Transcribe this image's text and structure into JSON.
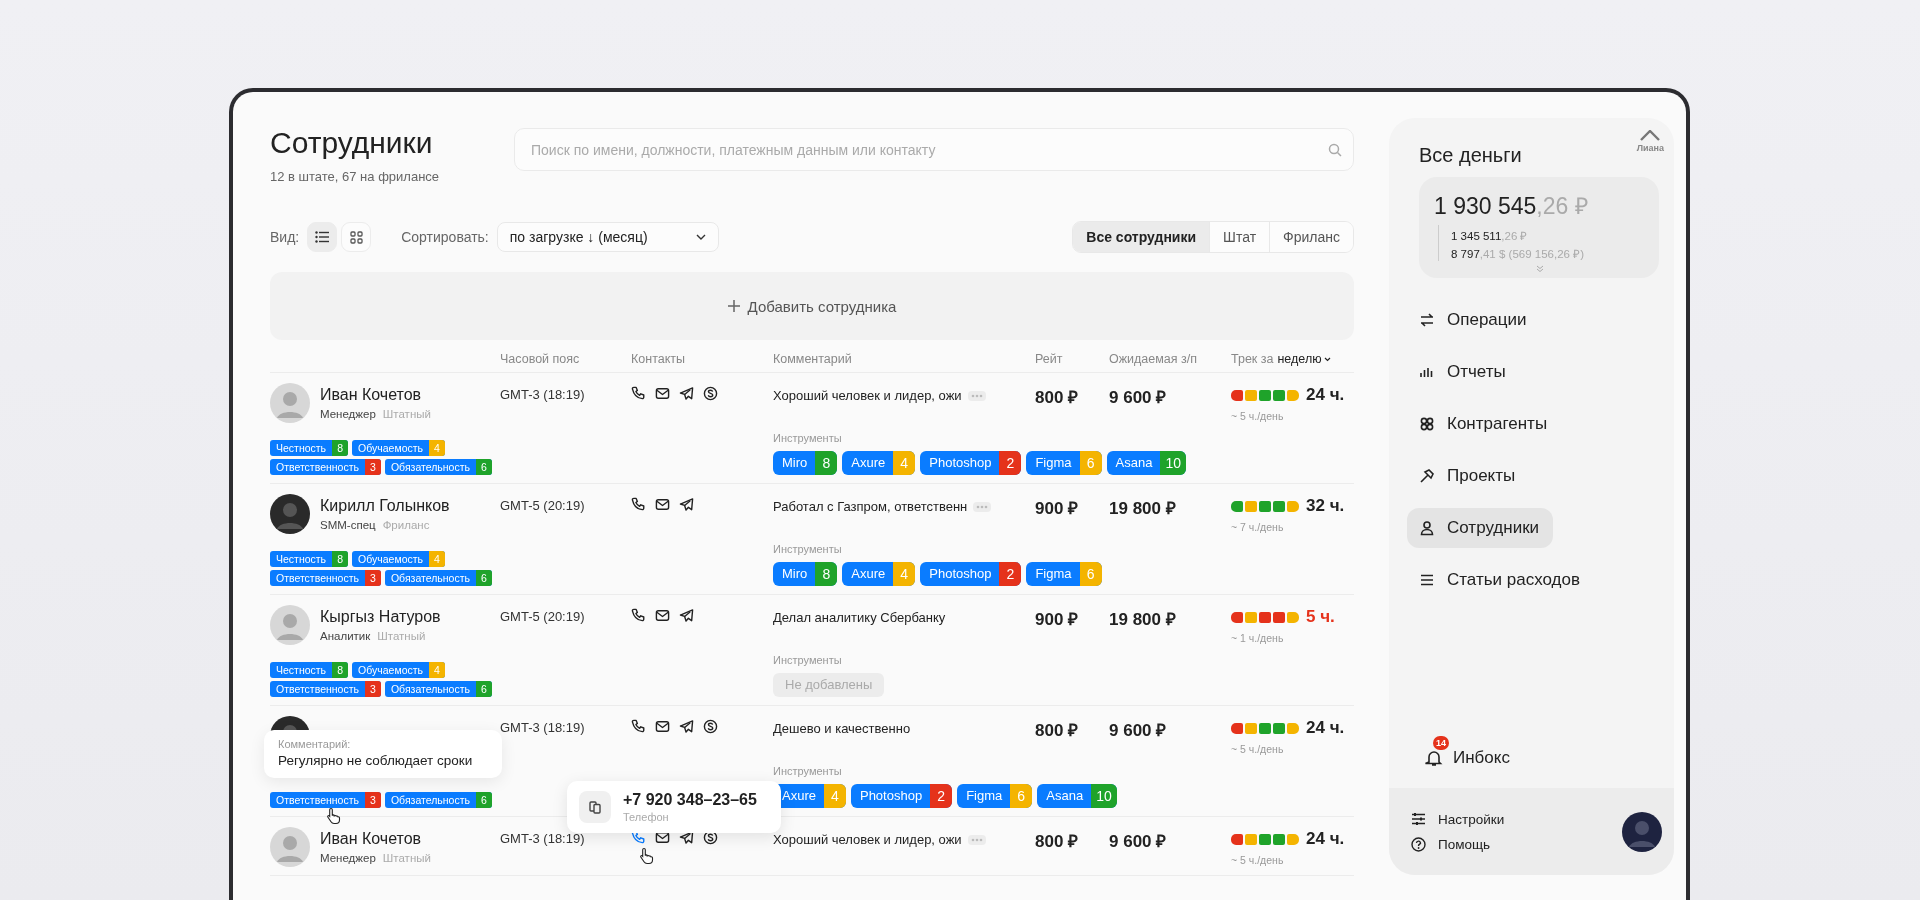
{
  "header": {
    "title": "Сотрудники",
    "subtitle": "12 в штате, 67 на фрилансе",
    "search": {
      "placeholder": "Поиск по имени, должности, платежным данным или контакту"
    }
  },
  "controls": {
    "view_label": "Вид:",
    "views": [
      {
        "kind": "list",
        "selected": true
      },
      {
        "kind": "grid",
        "selected": false
      }
    ],
    "sort_label": "Сортировать:",
    "sort_value": "по загрузке ↓ (месяц)",
    "filters": [
      {
        "label": "Все сотрудники",
        "selected": true
      },
      {
        "label": "Штат",
        "selected": false
      },
      {
        "label": "Фриланс",
        "selected": false
      }
    ]
  },
  "add_button": "Добавить сотрудника",
  "columns": [
    "Часовой пояс",
    "Контакты",
    "Комментарий",
    "Рейт",
    "Ожидаемая з/п"
  ],
  "track_header": {
    "label": "Трек за",
    "period": "неделю"
  },
  "rows": [
    {
      "name": "Иван Кочетов",
      "role": "Менеджер",
      "type": "Штатный",
      "timezone": "GMT-3 (18:19)",
      "contacts": [
        {
          "kind": "phone",
          "active": false
        },
        {
          "kind": "mail",
          "active": false
        },
        {
          "kind": "telegram",
          "active": false
        },
        {
          "kind": "skype",
          "active": false
        }
      ],
      "comment": "Хороший человек и лидер, ожи",
      "truncated": true,
      "rate": "800 ₽",
      "pay": "9 600 ₽",
      "track": [
        {
          "color": "#e5321b"
        },
        {
          "color": "#f4b400"
        },
        {
          "color": "#1fa32a"
        },
        {
          "color": "#1fa32a"
        },
        {
          "color": "#f4b400"
        }
      ],
      "hours": "24 ч.",
      "warning": false,
      "per_day": "~ 5 ч./день",
      "traits": [
        {
          "name": "Честность",
          "score": "8",
          "color": "#1fa32a"
        },
        {
          "name": "Обучаемость",
          "score": "4",
          "color": "#f4b400"
        },
        {
          "name": "Ответственность",
          "score": "3",
          "color": "#e5321b"
        },
        {
          "name": "Обязательность",
          "score": "6",
          "color": "#1fa32a"
        }
      ],
      "tools_label": "Инструменты",
      "tools": [
        {
          "name": "Miro",
          "score": "8",
          "color": "#1fa32a"
        },
        {
          "name": "Axure",
          "score": "4",
          "color": "#f4b400"
        },
        {
          "name": "Photoshop",
          "score": "2",
          "color": "#e5321b"
        },
        {
          "name": "Figma",
          "score": "6",
          "color": "#f4b400"
        },
        {
          "name": "Asana",
          "score": "10",
          "color": "#1fa32a"
        }
      ]
    },
    {
      "name": "Кирилл Голынков",
      "role": "SMM-спец",
      "type": "Фриланс",
      "timezone": "GMT-5 (20:19)",
      "contacts": [
        {
          "kind": "phone",
          "active": false
        },
        {
          "kind": "mail",
          "active": false
        },
        {
          "kind": "telegram",
          "active": false
        }
      ],
      "comment": "Работал с Газпром, ответственн",
      "truncated": true,
      "rate": "900 ₽",
      "pay": "19 800 ₽",
      "track": [
        {
          "color": "#1fa32a"
        },
        {
          "color": "#f4b400"
        },
        {
          "color": "#1fa32a"
        },
        {
          "color": "#1fa32a"
        },
        {
          "color": "#f4b400"
        }
      ],
      "hours": "32 ч.",
      "warning": false,
      "per_day": "~ 7 ч./день",
      "traits": [
        {
          "name": "Честность",
          "score": "8",
          "color": "#1fa32a"
        },
        {
          "name": "Обучаемость",
          "score": "4",
          "color": "#f4b400"
        },
        {
          "name": "Ответственность",
          "score": "3",
          "color": "#e5321b"
        },
        {
          "name": "Обязательность",
          "score": "6",
          "color": "#1fa32a"
        }
      ],
      "tools_label": "Инструменты",
      "tools": [
        {
          "name": "Miro",
          "score": "8",
          "color": "#1fa32a"
        },
        {
          "name": "Axure",
          "score": "4",
          "color": "#f4b400"
        },
        {
          "name": "Photoshop",
          "score": "2",
          "color": "#e5321b"
        },
        {
          "name": "Figma",
          "score": "6",
          "color": "#f4b400"
        }
      ]
    },
    {
      "name": "Кыргыз Натуров",
      "role": "Аналитик",
      "type": "Штатный",
      "timezone": "GMT-5 (20:19)",
      "contacts": [
        {
          "kind": "phone",
          "active": false
        },
        {
          "kind": "mail",
          "active": false
        },
        {
          "kind": "telegram",
          "active": false
        }
      ],
      "comment": "Делал аналитику Сбербанку",
      "truncated": false,
      "rate": "900 ₽",
      "pay": "19 800 ₽",
      "track": [
        {
          "color": "#e5321b"
        },
        {
          "color": "#f4b400"
        },
        {
          "color": "#e5321b"
        },
        {
          "color": "#e5321b"
        },
        {
          "color": "#f4b400"
        }
      ],
      "hours": "5 ч.",
      "warning": true,
      "per_day": "~ 1 ч./день",
      "traits": [
        {
          "name": "Честность",
          "score": "8",
          "color": "#1fa32a"
        },
        {
          "name": "Обучаемость",
          "score": "4",
          "color": "#f4b400"
        },
        {
          "name": "Ответственность",
          "score": "3",
          "color": "#e5321b"
        },
        {
          "name": "Обязательность",
          "score": "6",
          "color": "#1fa32a"
        }
      ],
      "tools_label": "Инструменты",
      "tools_placeholder": "Не добавлены"
    },
    {
      "timezone": "GMT-3 (18:19)",
      "contacts": [
        {
          "kind": "phone",
          "active": false
        },
        {
          "kind": "mail",
          "active": false
        },
        {
          "kind": "telegram",
          "active": false
        },
        {
          "kind": "skype",
          "active": false
        }
      ],
      "comment": "Дешево и качественно",
      "truncated": false,
      "rate": "800 ₽",
      "pay": "9 600 ₽",
      "track": [
        {
          "color": "#e5321b"
        },
        {
          "color": "#f4b400"
        },
        {
          "color": "#1fa32a"
        },
        {
          "color": "#1fa32a"
        },
        {
          "color": "#f4b400"
        }
      ],
      "hours": "24 ч.",
      "warning": false,
      "per_day": "~ 5 ч./день",
      "traits": [
        {
          "name": "Ответственность",
          "score": "3",
          "color": "#e5321b"
        },
        {
          "name": "Обязательность",
          "score": "6",
          "color": "#1fa32a"
        }
      ],
      "tools_label": "Инструменты",
      "tools": [
        {
          "name": "Axure",
          "score": "4",
          "color": "#f4b400"
        },
        {
          "name": "Photoshop",
          "score": "2",
          "color": "#e5321b"
        },
        {
          "name": "Figma",
          "score": "6",
          "color": "#f4b400"
        },
        {
          "name": "Asana",
          "score": "10",
          "color": "#1fa32a"
        }
      ],
      "comment_popup": {
        "label": "Комментарий:",
        "text": "Регулярно не соблюдает сроки"
      }
    },
    {
      "name": "Иван Кочетов",
      "role": "Менеджер",
      "type": "Штатный",
      "timezone": "GMT-3 (18:19)",
      "contacts": [
        {
          "kind": "phone",
          "active": true
        },
        {
          "kind": "mail",
          "active": false
        },
        {
          "kind": "telegram",
          "active": false
        },
        {
          "kind": "skype",
          "active": false
        }
      ],
      "comment": "Хороший человек и лидер, ожи",
      "truncated": true,
      "rate": "800 ₽",
      "pay": "9 600 ₽",
      "track": [
        {
          "color": "#e5321b"
        },
        {
          "color": "#f4b400"
        },
        {
          "color": "#1fa32a"
        },
        {
          "color": "#1fa32a"
        },
        {
          "color": "#f4b400"
        }
      ],
      "hours": "24 ч.",
      "warning": false,
      "per_day": "~ 5 ч./день",
      "phone_popup": {
        "number": "+7 920 348–23–65",
        "label": "Телефон"
      }
    }
  ],
  "sidebar": {
    "title": "Все деньги",
    "logo_text": "Лиана",
    "balance": {
      "whole": "1 930 545",
      "rest": ",26 ₽",
      "lines": [
        {
          "whole": "1 345 511",
          "rest": ",26 ₽"
        },
        {
          "whole": "8 797",
          "rest": ",41 $ (569 156,26 ₽)"
        }
      ]
    },
    "nav": [
      {
        "label": "Операции",
        "kind": "operations",
        "selected": false
      },
      {
        "label": "Отчеты",
        "kind": "reports",
        "selected": false
      },
      {
        "label": "Контрагенты",
        "kind": "counterparties",
        "selected": false
      },
      {
        "label": "Проекты",
        "kind": "projects",
        "selected": false
      },
      {
        "label": "Сотрудники",
        "kind": "employees",
        "selected": true
      },
      {
        "label": "Статьи расходов",
        "kind": "expenses",
        "selected": false
      }
    ],
    "inbox": {
      "label": "Инбокс",
      "count": "14"
    },
    "footer": [
      {
        "label": "Настройки",
        "kind": "settings"
      },
      {
        "label": "Помощь",
        "kind": "help"
      }
    ]
  }
}
